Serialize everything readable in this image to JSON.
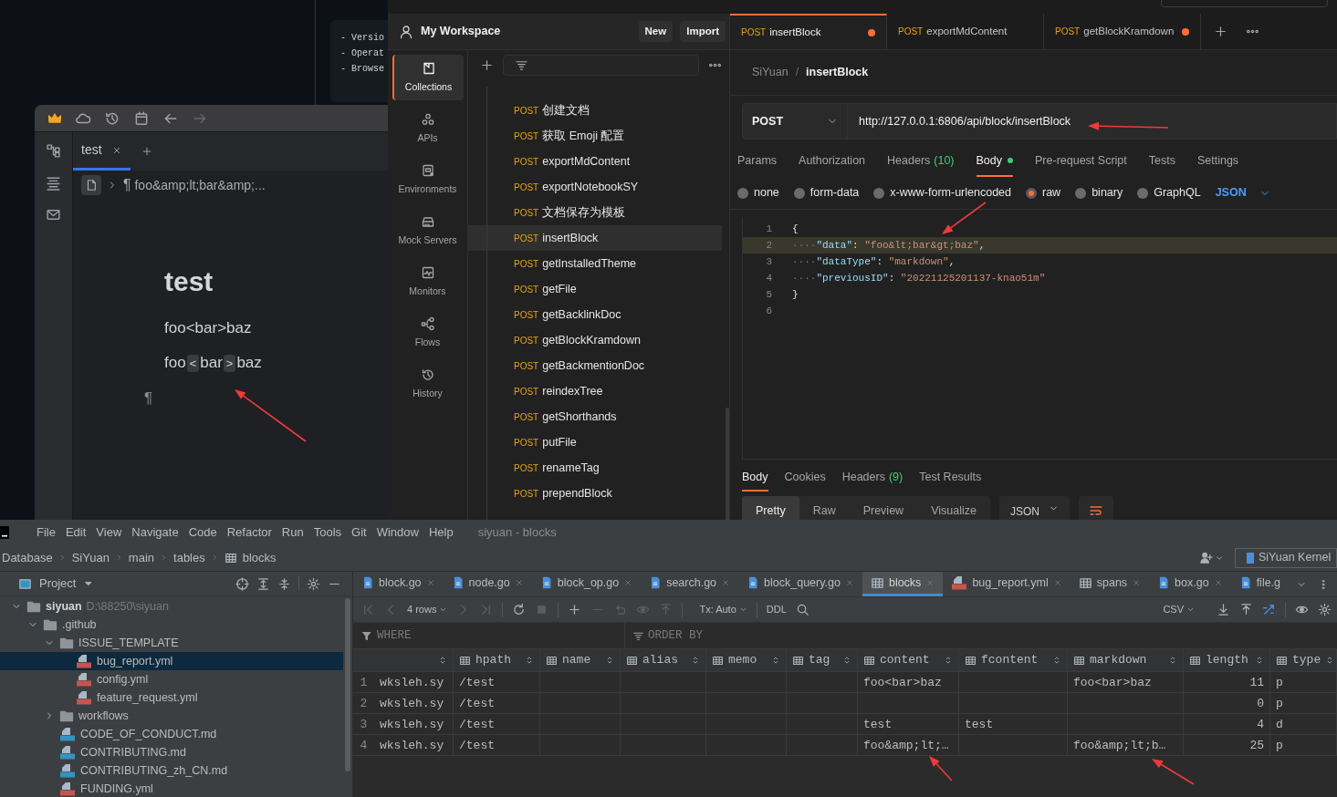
{
  "github_page": {
    "code_lines": [
      "- Versio",
      "- Operat",
      "- Browse"
    ]
  },
  "siyuan": {
    "tabs": [
      {
        "label": "test",
        "selected": true
      }
    ],
    "breadcrumb": {
      "mark": "¶",
      "text": "foo&amp;lt;bar&amp;..."
    },
    "title": "test",
    "paragraphs": [
      [
        {
          "text": "foo<bar>baz",
          "code": false
        }
      ],
      [
        {
          "text": "foo",
          "code": false
        },
        {
          "text": "<",
          "code": true
        },
        {
          "text": "bar",
          "code": false
        },
        {
          "text": ">",
          "code": true
        },
        {
          "text": "baz",
          "code": false
        }
      ]
    ],
    "empty_mark": "¶"
  },
  "postman": {
    "workspace": "My Workspace",
    "buttons": [
      "New",
      "Import"
    ],
    "nav": [
      {
        "label": "Collections",
        "kind": "collections",
        "selected": true
      },
      {
        "label": "APIs",
        "kind": "apis",
        "selected": false
      },
      {
        "label": "Environments",
        "kind": "environments",
        "selected": false
      },
      {
        "label": "Mock Servers",
        "kind": "mock",
        "selected": false
      },
      {
        "label": "Monitors",
        "kind": "monitors",
        "selected": false
      },
      {
        "label": "Flows",
        "kind": "flows",
        "selected": false
      },
      {
        "label": "History",
        "kind": "history",
        "selected": false
      }
    ],
    "requests": [
      {
        "method": "POST",
        "name": "创建文档",
        "selected": false
      },
      {
        "method": "POST",
        "name": "获取 Emoji 配置",
        "selected": false
      },
      {
        "method": "POST",
        "name": "exportMdContent",
        "selected": false
      },
      {
        "method": "POST",
        "name": "exportNotebookSY",
        "selected": false
      },
      {
        "method": "POST",
        "name": "文档保存为模板",
        "selected": false
      },
      {
        "method": "POST",
        "name": "insertBlock",
        "selected": true
      },
      {
        "method": "POST",
        "name": "getInstalledTheme",
        "selected": false
      },
      {
        "method": "POST",
        "name": "getFile",
        "selected": false
      },
      {
        "method": "POST",
        "name": "getBacklinkDoc",
        "selected": false
      },
      {
        "method": "POST",
        "name": "getBlockKramdown",
        "selected": false
      },
      {
        "method": "POST",
        "name": "getBackmentionDoc",
        "selected": false
      },
      {
        "method": "POST",
        "name": "reindexTree",
        "selected": false
      },
      {
        "method": "POST",
        "name": "getShorthands",
        "selected": false
      },
      {
        "method": "POST",
        "name": "putFile",
        "selected": false
      },
      {
        "method": "POST",
        "name": "renameTag",
        "selected": false
      },
      {
        "method": "POST",
        "name": "prependBlock",
        "selected": false
      }
    ],
    "tabs": [
      {
        "method": "POST",
        "name": "insertBlock",
        "selected": true,
        "unsaved": true
      },
      {
        "method": "POST",
        "name": "exportMdContent",
        "selected": false,
        "unsaved": false
      },
      {
        "method": "POST",
        "name": "getBlockKramdown",
        "selected": false,
        "unsaved": true
      }
    ],
    "breadcrumb": [
      "SiYuan",
      "insertBlock"
    ],
    "breadcrumb_separator": "/",
    "method": "POST",
    "url": "http://127.0.0.1:6806/api/block/insertBlock",
    "request_tabs": [
      {
        "label": "Params",
        "selected": false,
        "dot": false
      },
      {
        "label": "Authorization",
        "selected": false,
        "dot": false
      },
      {
        "label": "Headers",
        "count": "(10)",
        "selected": false,
        "dot": false
      },
      {
        "label": "Body",
        "selected": true,
        "dot": true
      },
      {
        "label": "Pre-request Script",
        "selected": false,
        "dot": false
      },
      {
        "label": "Tests",
        "selected": false,
        "dot": false
      },
      {
        "label": "Settings",
        "selected": false,
        "dot": false
      }
    ],
    "body_types": [
      {
        "label": "none",
        "selected": false
      },
      {
        "label": "form-data",
        "selected": false
      },
      {
        "label": "x-www-form-urlencoded",
        "selected": false
      },
      {
        "label": "raw",
        "selected": true
      },
      {
        "label": "binary",
        "selected": false
      },
      {
        "label": "GraphQL",
        "selected": false
      }
    ],
    "body_format": "JSON",
    "code": [
      {
        "number": "1",
        "highlighted": false,
        "tokens": [
          {
            "kind": "punct",
            "text": "{"
          }
        ]
      },
      {
        "number": "2",
        "highlighted": true,
        "tokens": [
          {
            "kind": "ws",
            "text": "····"
          },
          {
            "kind": "key",
            "text": "\"data\""
          },
          {
            "kind": "punct",
            "text": ": "
          },
          {
            "kind": "string",
            "text": "\"foo&lt;bar&gt;baz\""
          },
          {
            "kind": "punct",
            "text": ","
          }
        ]
      },
      {
        "number": "3",
        "highlighted": false,
        "tokens": [
          {
            "kind": "ws",
            "text": "····"
          },
          {
            "kind": "key",
            "text": "\"dataType\""
          },
          {
            "kind": "punct",
            "text": ": "
          },
          {
            "kind": "string",
            "text": "\"markdown\""
          },
          {
            "kind": "punct",
            "text": ","
          }
        ]
      },
      {
        "number": "4",
        "highlighted": false,
        "tokens": [
          {
            "kind": "ws",
            "text": "····"
          },
          {
            "kind": "key",
            "text": "\"previousID\""
          },
          {
            "kind": "punct",
            "text": ": "
          },
          {
            "kind": "string",
            "text": "\"20221125201137-knao51m\""
          }
        ]
      },
      {
        "number": "5",
        "highlighted": false,
        "tokens": [
          {
            "kind": "punct",
            "text": "}"
          }
        ]
      },
      {
        "number": "6",
        "highlighted": false
      }
    ],
    "response_tabs": [
      {
        "label": "Body",
        "selected": true
      },
      {
        "label": "Cookies",
        "selected": false
      },
      {
        "label": "Headers",
        "count": "(9)",
        "selected": false
      },
      {
        "label": "Test Results",
        "selected": false
      }
    ],
    "response_views": [
      {
        "label": "Pretty",
        "selected": true
      },
      {
        "label": "Raw",
        "selected": false
      },
      {
        "label": "Preview",
        "selected": false
      },
      {
        "label": "Visualize",
        "selected": false
      }
    ],
    "response_format": "JSON"
  },
  "ide": {
    "menu": [
      "File",
      "Edit",
      "View",
      "Navigate",
      "Code",
      "Refactor",
      "Run",
      "Tools",
      "Git",
      "Window",
      "Help"
    ],
    "title": "siyuan - blocks",
    "breadcrumb": [
      "Database",
      "SiYuan",
      "main",
      "tables",
      "blocks"
    ],
    "kernel": "SiYuan Kernel",
    "project_label": "Project",
    "tree": [
      {
        "label": "siyuan",
        "path": "D:\\88250\\siyuan",
        "kind": "folder",
        "expanded": true,
        "selected": false,
        "children": [
          {
            "label": ".github",
            "kind": "folder",
            "expanded": true,
            "selected": false,
            "children": [
              {
                "label": "ISSUE_TEMPLATE",
                "kind": "folder",
                "expanded": true,
                "selected": false,
                "children": [
                  {
                    "label": "bug_report.yml",
                    "kind": "yml",
                    "selected": true
                  },
                  {
                    "label": "config.yml",
                    "kind": "yml",
                    "selected": false
                  },
                  {
                    "label": "feature_request.yml",
                    "kind": "yml",
                    "selected": false
                  }
                ]
              },
              {
                "label": "workflows",
                "kind": "folder",
                "expanded": false,
                "selected": false
              },
              {
                "label": "CODE_OF_CONDUCT.md",
                "kind": "md",
                "selected": false
              },
              {
                "label": "CONTRIBUTING.md",
                "kind": "md",
                "selected": false
              },
              {
                "label": "CONTRIBUTING_zh_CN.md",
                "kind": "md",
                "selected": false
              },
              {
                "label": "FUNDING.yml",
                "kind": "yml",
                "selected": false
              }
            ]
          }
        ]
      }
    ],
    "tabs": [
      {
        "label": "block.go",
        "kind": "go",
        "selected": false
      },
      {
        "label": "node.go",
        "kind": "go",
        "selected": false
      },
      {
        "label": "block_op.go",
        "kind": "go",
        "selected": false
      },
      {
        "label": "search.go",
        "kind": "go",
        "selected": false
      },
      {
        "label": "block_query.go",
        "kind": "go",
        "selected": false
      },
      {
        "label": "blocks",
        "kind": "table",
        "selected": true
      },
      {
        "label": "bug_report.yml",
        "kind": "yml",
        "selected": false
      },
      {
        "label": "spans",
        "kind": "table",
        "selected": false
      },
      {
        "label": "box.go",
        "kind": "go",
        "selected": false
      },
      {
        "label": "file.g",
        "kind": "go",
        "selected": false
      }
    ],
    "toolbar": {
      "rows": "4 rows",
      "tx": "Tx: Auto",
      "ddl": "DDL",
      "export": "CSV"
    },
    "filter": {
      "where": "WHERE",
      "order": "ORDER BY"
    },
    "table": {
      "columns": [
        "",
        "hpath",
        "name",
        "alias",
        "memo",
        "tag",
        "content",
        "fcontent",
        "markdown",
        "length",
        "type"
      ],
      "rows": [
        {
          "number": "1",
          "cells": [
            "wksleh.sy",
            "/test",
            null,
            null,
            null,
            null,
            "foo<bar>baz",
            null,
            "foo<bar>baz",
            "11",
            "p"
          ]
        },
        {
          "number": "2",
          "cells": [
            "wksleh.sy",
            "/test",
            null,
            null,
            null,
            null,
            null,
            null,
            null,
            "0",
            "p"
          ]
        },
        {
          "number": "3",
          "cells": [
            "wksleh.sy",
            "/test",
            null,
            null,
            null,
            null,
            "test",
            "test",
            null,
            "4",
            "d"
          ]
        },
        {
          "number": "4",
          "cells": [
            "wksleh.sy",
            "/test",
            null,
            null,
            null,
            null,
            "foo&amp;lt;…",
            null,
            "foo&amp;lt;b…",
            "25",
            "p"
          ]
        }
      ]
    }
  }
}
